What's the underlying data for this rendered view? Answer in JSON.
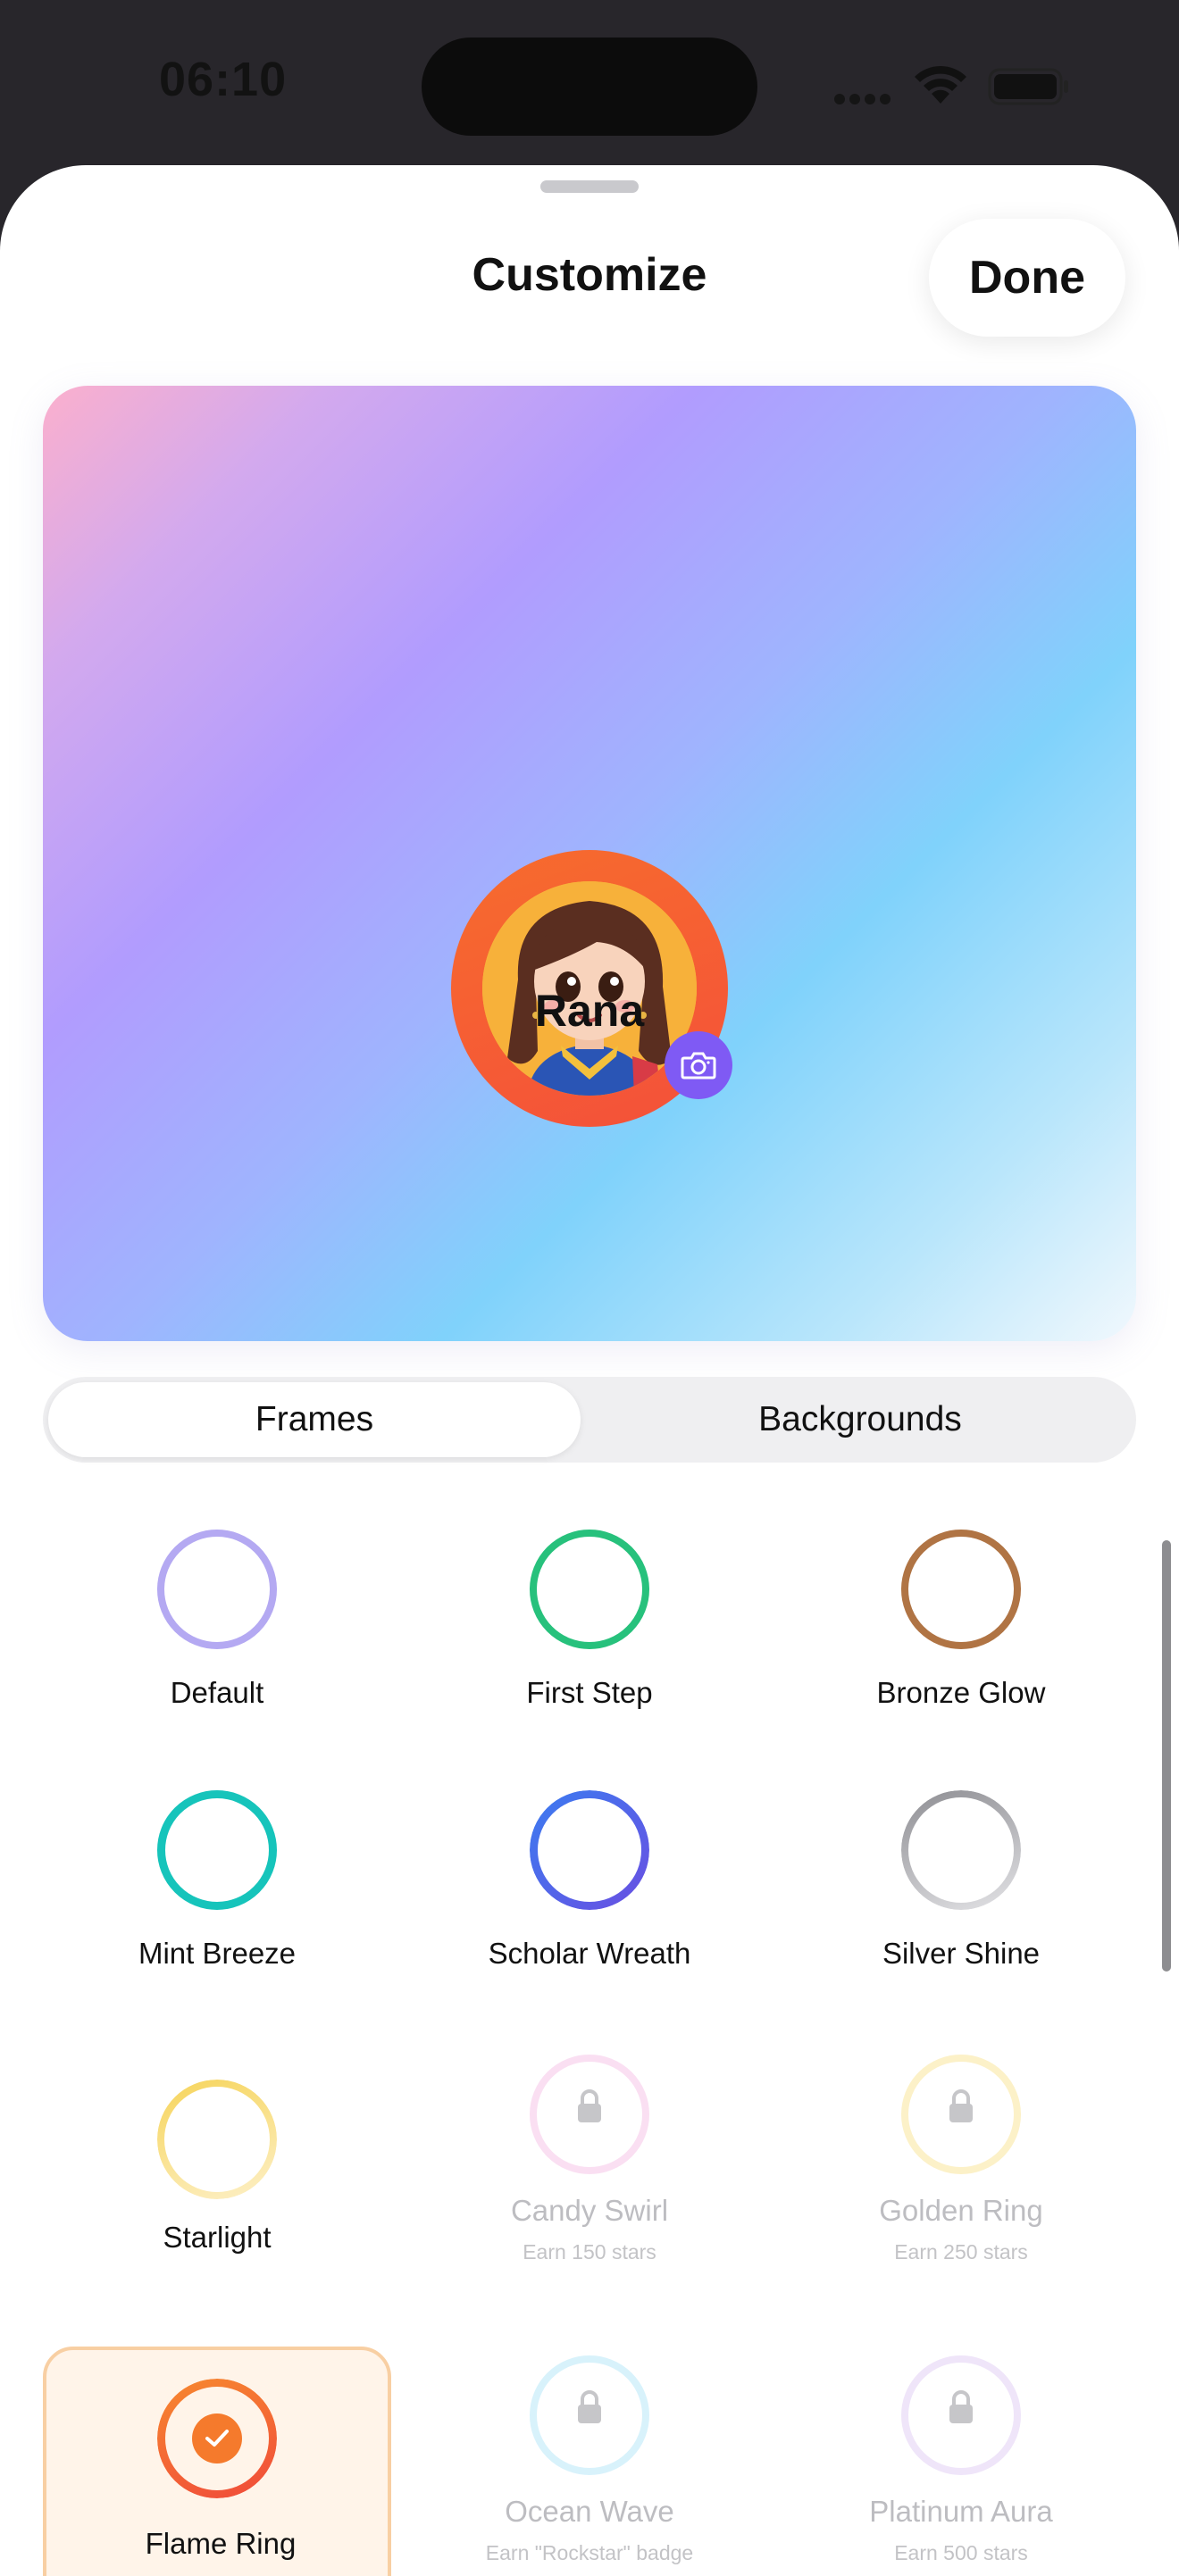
{
  "status_bar": {
    "time": "06:10"
  },
  "sheet": {
    "title": "Customize",
    "done_label": "Done"
  },
  "preview": {
    "name": "Rana",
    "frame_color": "#f4603a",
    "camera_icon": "camera-icon"
  },
  "tabs": [
    {
      "label": "Frames",
      "selected": true
    },
    {
      "label": "Backgrounds",
      "selected": false
    }
  ],
  "frames": [
    {
      "name": "Default",
      "subtitle": "",
      "locked": false,
      "selected": false,
      "color": "#b4a9f2"
    },
    {
      "name": "First Step",
      "subtitle": "",
      "locked": false,
      "selected": false,
      "color": "#27c17c"
    },
    {
      "name": "Bronze Glow",
      "subtitle": "",
      "locked": false,
      "selected": false,
      "color": "#b07444"
    },
    {
      "name": "Mint Breeze",
      "subtitle": "",
      "locked": false,
      "selected": false,
      "color": "#16c4bb"
    },
    {
      "name": "Scholar Wreath",
      "subtitle": "",
      "locked": false,
      "selected": false,
      "color": "#4c63ec"
    },
    {
      "name": "Silver Shine",
      "subtitle": "",
      "locked": false,
      "selected": false,
      "color": "#a6a6ab"
    },
    {
      "name": "Starlight",
      "subtitle": "",
      "locked": false,
      "selected": false,
      "color": "#f8d870"
    },
    {
      "name": "Candy Swirl",
      "subtitle": "Earn 150 stars",
      "locked": true,
      "selected": false,
      "color": "#f3b8e3"
    },
    {
      "name": "Golden Ring",
      "subtitle": "Earn 250 stars",
      "locked": true,
      "selected": false,
      "color": "#f8df86"
    },
    {
      "name": "Flame Ring",
      "subtitle": "",
      "locked": false,
      "selected": true,
      "color": "#f4603a"
    },
    {
      "name": "Ocean Wave",
      "subtitle": "Earn \"Rockstar\" badge",
      "locked": true,
      "selected": false,
      "color": "#a9e3f6"
    },
    {
      "name": "Platinum Aura",
      "subtitle": "Earn 500 stars",
      "locked": true,
      "selected": false,
      "color": "#dcc6f1"
    }
  ]
}
